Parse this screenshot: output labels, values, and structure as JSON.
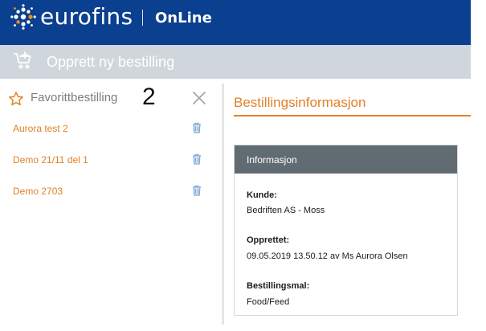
{
  "header": {
    "logo_text": "eurofins",
    "logo_sub": "OnLine",
    "logo_icon": "eurofins-dots-logo",
    "brand_color": "#0b3f8f"
  },
  "subbar": {
    "title": "Opprett ny bestilling",
    "icon": "cart-add-icon"
  },
  "favorites": {
    "title": "Favorittbestilling",
    "count": "2",
    "items": [
      {
        "label": "Aurora test 2"
      },
      {
        "label": "Demo 21/11 del 1"
      },
      {
        "label": "Demo 2703"
      }
    ],
    "accent_color": "#e08127"
  },
  "order_info": {
    "title": "Bestillingsinformasjon",
    "card_title": "Informasjon",
    "fields": [
      {
        "label": "Kunde:",
        "value": "Bedriften AS - Moss"
      },
      {
        "label": "Opprettet:",
        "value": "09.05.2019 13.50.12 av Ms Aurora Olsen"
      },
      {
        "label": "Bestillingsmal:",
        "value": "Food/Feed"
      }
    ]
  }
}
